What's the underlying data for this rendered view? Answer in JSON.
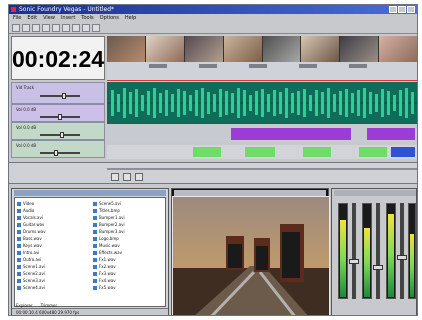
{
  "app": {
    "title": "Sonic Foundry Vegas - Untitled*"
  },
  "menu": [
    "File",
    "Edit",
    "View",
    "Insert",
    "Tools",
    "Options",
    "Help"
  ],
  "time": "00:02:24",
  "colors": {
    "video_track": "#cbbde8",
    "audio_track": "#b9dcc4",
    "waveform": "#20a07a",
    "purple_wave": "#9b3cd6",
    "meter": "#6fdc6a"
  },
  "tracks": [
    {
      "id": "v1",
      "name": "Vid Track",
      "icon": "film-icon"
    },
    {
      "id": "a1",
      "name": "Vol 0.0 dB",
      "icon": "speaker-icon"
    },
    {
      "id": "a2",
      "name": "Vol 0.0 dB",
      "icon": "speaker-icon"
    },
    {
      "id": "a3",
      "name": "Vol 0.0 dB",
      "icon": "speaker-icon"
    }
  ],
  "explorer": {
    "files": [
      "Video",
      "Audio",
      "Vocals.avi",
      "Guitar.wav",
      "Drums.wav",
      "Bass.wav",
      "Keys.wav",
      "Intro.avi",
      "Outro.avi",
      "Scene1.avi",
      "Scene2.avi",
      "Scene3.avi",
      "Scene4.avi",
      "Scene5.avi",
      "Titles.bmp",
      "Bumper1.avi",
      "Bumper2.avi",
      "Bumper3.avi",
      "Logo.bmp",
      "Music.wav",
      "Effects.wav",
      "Fx1.wav",
      "Fx2.wav",
      "Fx3.wav",
      "Fx4.wav",
      "Fx5.wav"
    ],
    "tabs": [
      "Explorer",
      "Trimmer"
    ],
    "status": "00:00:10.4 600x480 29.970 fps"
  },
  "mixer": {
    "channels": [
      {
        "level": 0.82
      },
      {
        "level": 0.73
      },
      {
        "level": 0.88
      },
      {
        "level": 0.67
      }
    ]
  }
}
